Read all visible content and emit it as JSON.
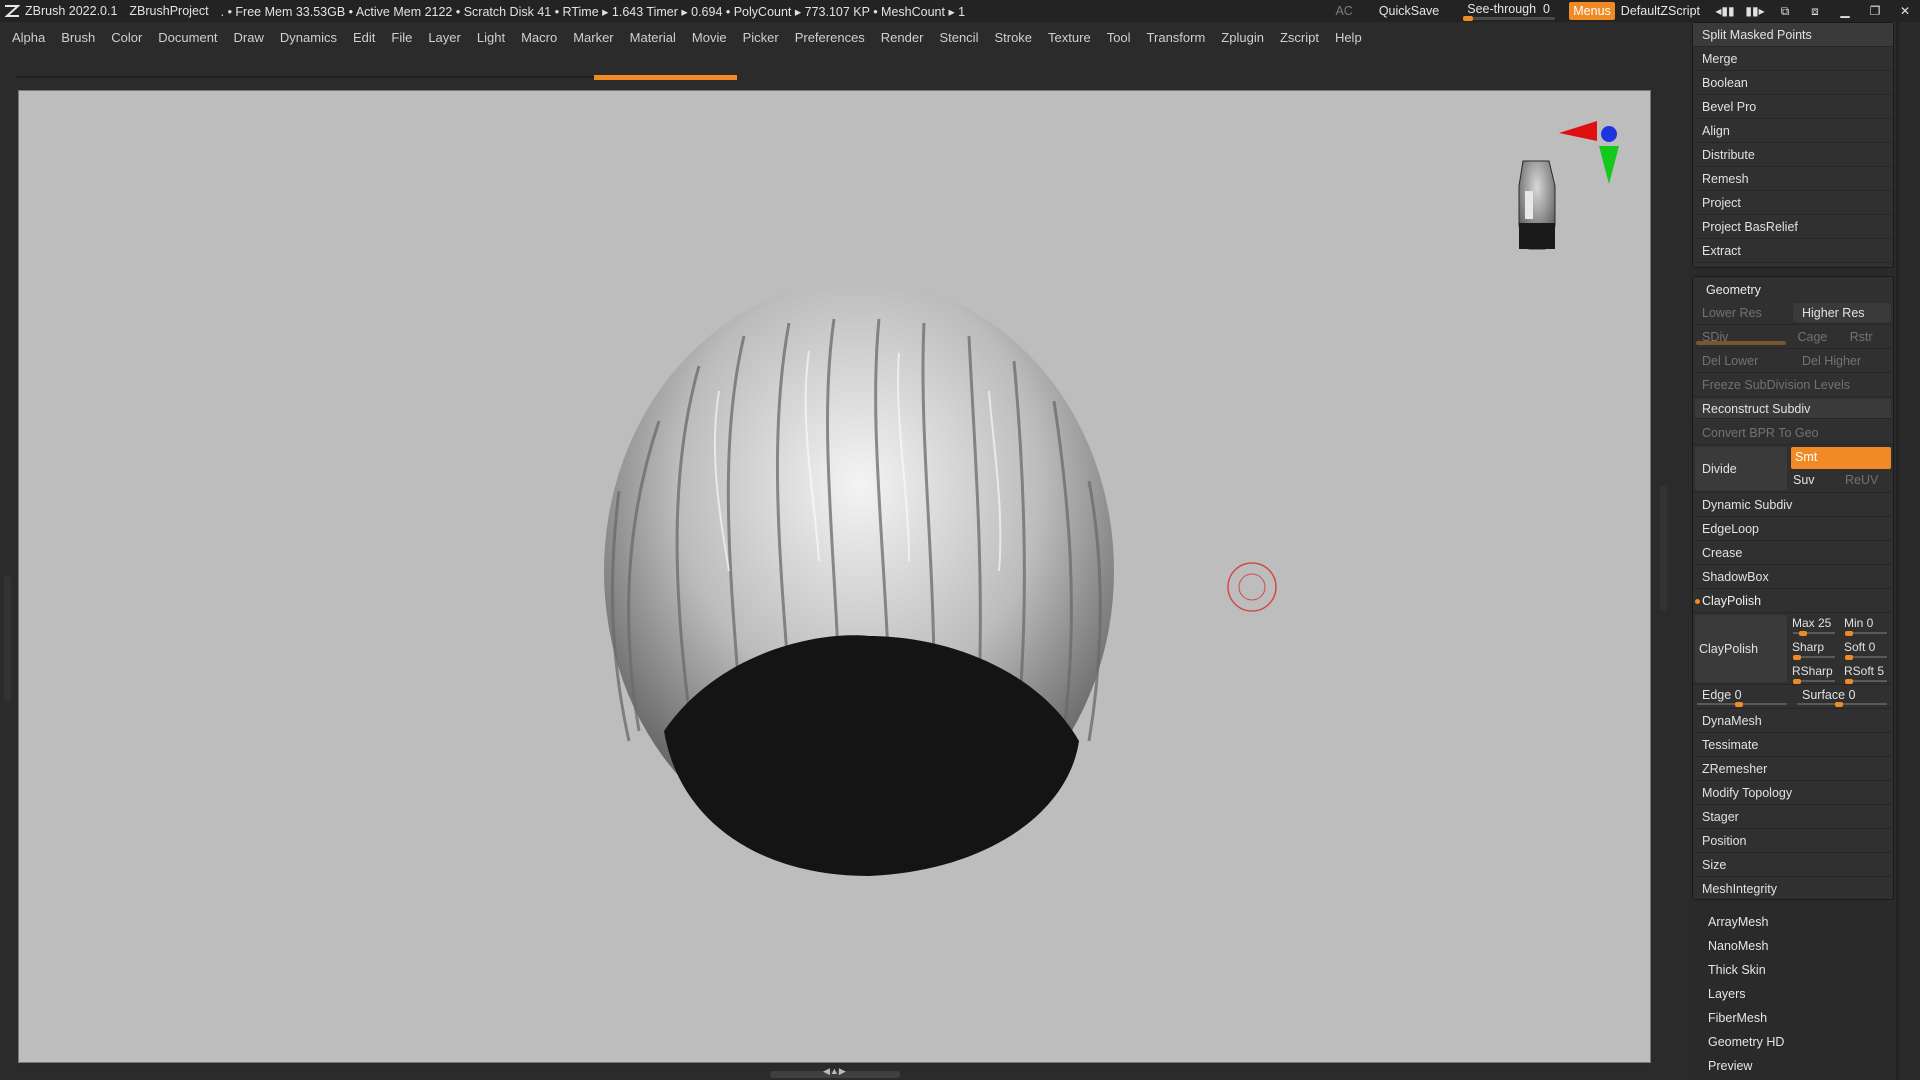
{
  "title_bar": {
    "app": "ZBrush 2022.0.1",
    "project": "ZBrushProject",
    "status": ". • Free Mem 33.53GB • Active Mem 2122 • Scratch Disk 41 •  RTime ▸ 1.643 Timer ▸ 0.694 • PolyCount ▸ 773.107 KP  • MeshCount ▸ 1",
    "ac": "AC",
    "quicksave": "QuickSave",
    "see_through_label": "See-through",
    "see_through_value": "0",
    "menus": "Menus",
    "script": "DefaultZScript"
  },
  "menu_bar": [
    "Alpha",
    "Brush",
    "Color",
    "Document",
    "Draw",
    "Dynamics",
    "Edit",
    "File",
    "Layer",
    "Light",
    "Macro",
    "Marker",
    "Material",
    "Movie",
    "Picker",
    "Preferences",
    "Render",
    "Stencil",
    "Stroke",
    "Texture",
    "Tool",
    "Transform",
    "Zplugin",
    "Zscript",
    "Help"
  ],
  "subtool_group": {
    "items": [
      "Split Masked Points",
      "Merge",
      "Boolean",
      "Bevel Pro",
      "Align",
      "Distribute",
      "Remesh",
      "Project",
      "Project BasRelief",
      "Extract"
    ]
  },
  "geometry": {
    "title": "Geometry",
    "lower_res": "Lower Res",
    "higher_res": "Higher Res",
    "sdiv": "SDiv",
    "cage": "Cage",
    "rstr": "Rstr",
    "del_lower": "Del Lower",
    "del_higher": "Del Higher",
    "freeze": "Freeze SubDivision Levels",
    "reconstruct": "Reconstruct Subdiv",
    "convert_bpr": "Convert BPR To Geo",
    "divide": "Divide",
    "smt": "Smt",
    "suv": "Suv",
    "reuv": "ReUV",
    "dynamic_subdiv": "Dynamic Subdiv",
    "edgeloop": "EdgeLoop",
    "crease": "Crease",
    "shadowbox": "ShadowBox",
    "claypolish_title": "ClayPolish",
    "claypolish_button": "ClayPolish",
    "max": "Max 25",
    "min": "Min 0",
    "sharp": "Sharp",
    "soft": "Soft 0",
    "rsharp": "RSharp",
    "rsoft": "RSoft 5",
    "edge": "Edge 0",
    "surface": "Surface 0",
    "items_after": [
      "DynaMesh",
      "Tessimate",
      "ZRemesher",
      "Modify Topology",
      "Stager",
      "Position",
      "Size",
      "MeshIntegrity"
    ]
  },
  "tool_subpalettes": [
    "ArrayMesh",
    "NanoMesh",
    "Thick Skin",
    "Layers",
    "FiberMesh",
    "Geometry HD",
    "Preview"
  ],
  "colors": {
    "accent": "#f08a24",
    "canvas": "#bdbdbd",
    "panel": "#303030"
  }
}
